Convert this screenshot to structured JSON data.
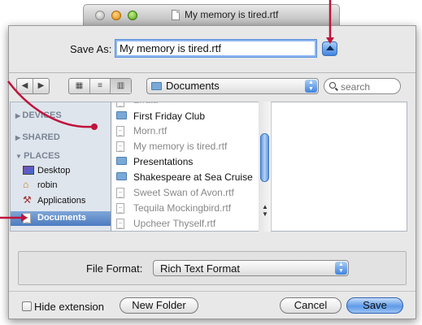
{
  "window": {
    "title": "My memory is tired.rtf"
  },
  "save_as": {
    "label": "Save As:",
    "value": "My memory is tired.rtf"
  },
  "toolbar": {
    "back_icon": "back-arrow",
    "forward_icon": "forward-arrow",
    "location": "Documents",
    "search_placeholder": "search"
  },
  "sidebar": {
    "devices": "DEVICES",
    "shared": "SHARED",
    "places": "PLACES",
    "items": [
      {
        "label": "Desktop",
        "icon": "desktop-icon"
      },
      {
        "label": "robin",
        "icon": "home-icon"
      },
      {
        "label": "Applications",
        "icon": "applications-icon"
      },
      {
        "label": "Documents",
        "icon": "documents-icon",
        "selected": true
      }
    ]
  },
  "files": [
    {
      "name": "First Friday Club",
      "kind": "folder"
    },
    {
      "name": "Morn.rtf",
      "kind": "file"
    },
    {
      "name": "My memory is tired.rtf",
      "kind": "file"
    },
    {
      "name": "Presentations",
      "kind": "folder"
    },
    {
      "name": "Shakespeare at Sea Cruise",
      "kind": "folder"
    },
    {
      "name": "Sweet Swan of Avon.rtf",
      "kind": "file"
    },
    {
      "name": "Tequila Mockingbird.rtf",
      "kind": "file"
    },
    {
      "name": "Upcheer Thyself.rtf",
      "kind": "file"
    }
  ],
  "format": {
    "label": "File Format:",
    "value": "Rich Text Format"
  },
  "footer": {
    "hide_extension": "Hide extension",
    "new_folder": "New Folder",
    "cancel": "Cancel",
    "save": "Save"
  },
  "colors": {
    "accent": "#3f84de",
    "annotation": "#c0143c",
    "selection": "#4d7cc0"
  }
}
